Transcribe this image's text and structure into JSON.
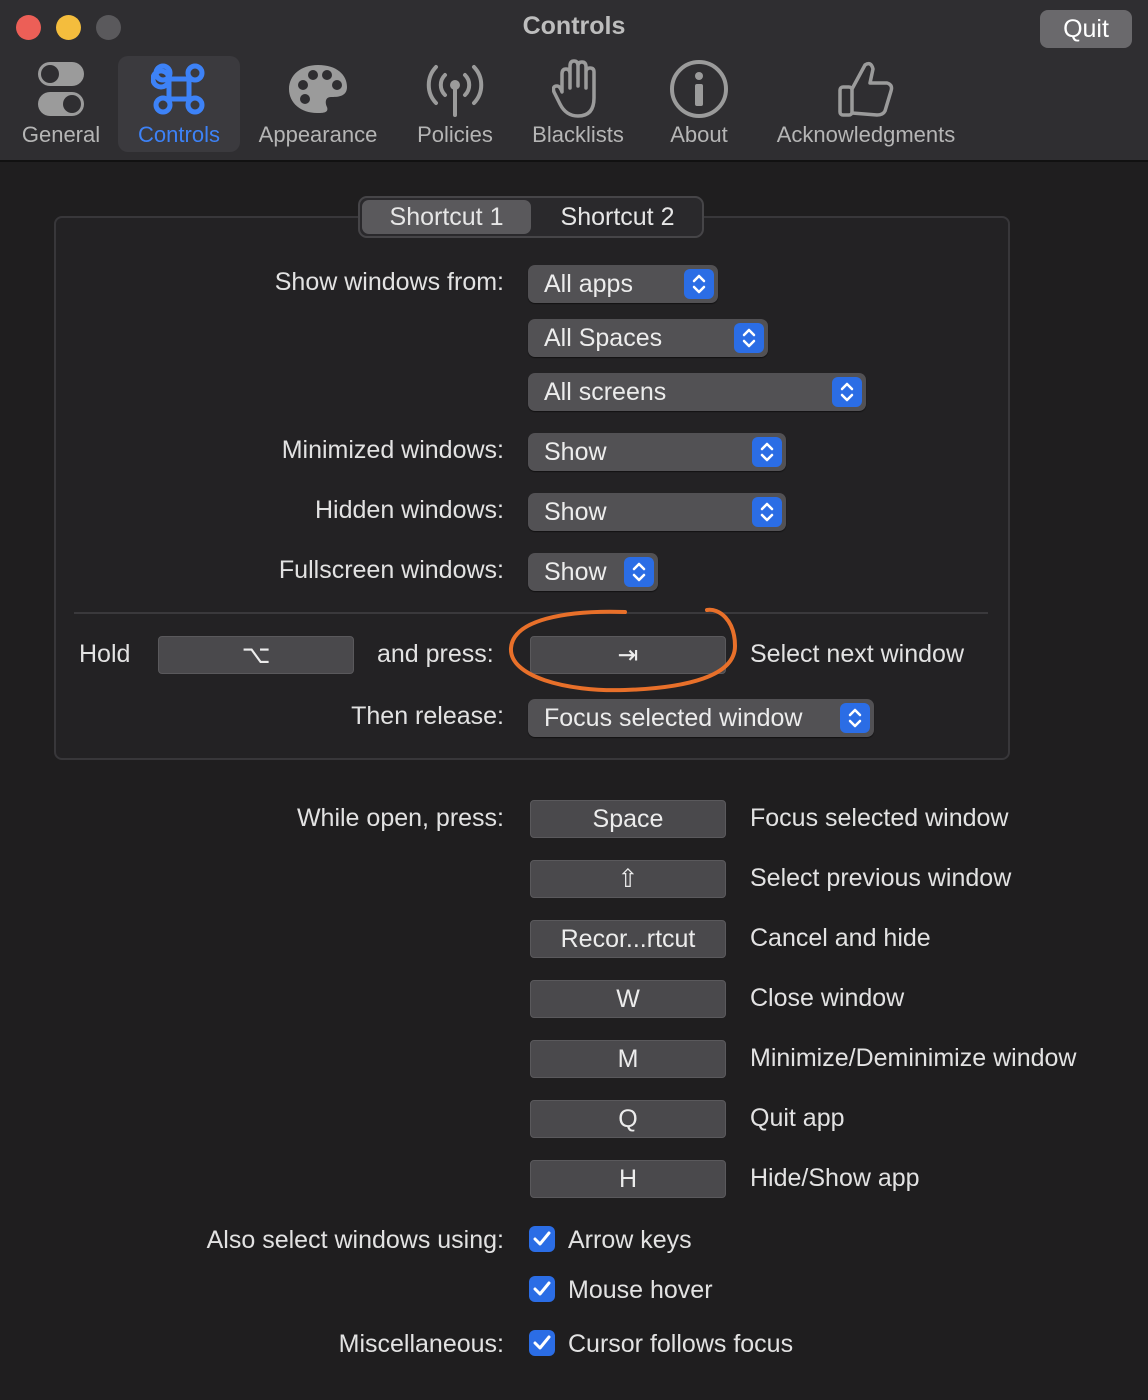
{
  "window": {
    "title": "Controls",
    "quit_label": "Quit"
  },
  "tabs": [
    {
      "label": "General",
      "icon": "toggles-icon"
    },
    {
      "label": "Controls",
      "icon": "command-icon",
      "active": true
    },
    {
      "label": "Appearance",
      "icon": "palette-icon"
    },
    {
      "label": "Policies",
      "icon": "antenna-icon"
    },
    {
      "label": "Blacklists",
      "icon": "hand-icon"
    },
    {
      "label": "About",
      "icon": "info-icon"
    },
    {
      "label": "Acknowledgments",
      "icon": "thumbs-up-icon"
    }
  ],
  "shortcut_tabs": [
    "Shortcut 1",
    "Shortcut 2"
  ],
  "shortcut": {
    "show_windows_from_label": "Show windows from:",
    "apps_value": "All apps",
    "spaces_value": "All Spaces",
    "screens_value": "All screens",
    "minimized_label": "Minimized windows:",
    "minimized_value": "Show",
    "hidden_label": "Hidden windows:",
    "hidden_value": "Show",
    "fullscreen_label": "Fullscreen windows:",
    "fullscreen_value": "Show",
    "hold_label": "Hold",
    "hold_key": "⌥",
    "and_press_label": "and press:",
    "press_key": "⇥",
    "press_action": "Select next window",
    "then_release_label": "Then release:",
    "release_value": "Focus selected window"
  },
  "while_open": {
    "label": "While open, press:",
    "rows": [
      {
        "key": "Space",
        "action": "Focus selected window"
      },
      {
        "key": "⇧",
        "action": "Select previous window"
      },
      {
        "key": "Recor...rtcut",
        "action": "Cancel and hide"
      },
      {
        "key": "W",
        "action": "Close window"
      },
      {
        "key": "M",
        "action": "Minimize/Deminimize window"
      },
      {
        "key": "Q",
        "action": "Quit app"
      },
      {
        "key": "H",
        "action": "Hide/Show app"
      }
    ]
  },
  "also_select": {
    "label": "Also select windows using:",
    "arrow_keys": "Arrow keys",
    "mouse_hover": "Mouse hover"
  },
  "misc": {
    "label": "Miscellaneous:",
    "cursor_follows": "Cursor follows focus"
  },
  "colors": {
    "accent": "#3d82f7",
    "stepper": "#2b6de5",
    "annotation": "#e8702a"
  }
}
